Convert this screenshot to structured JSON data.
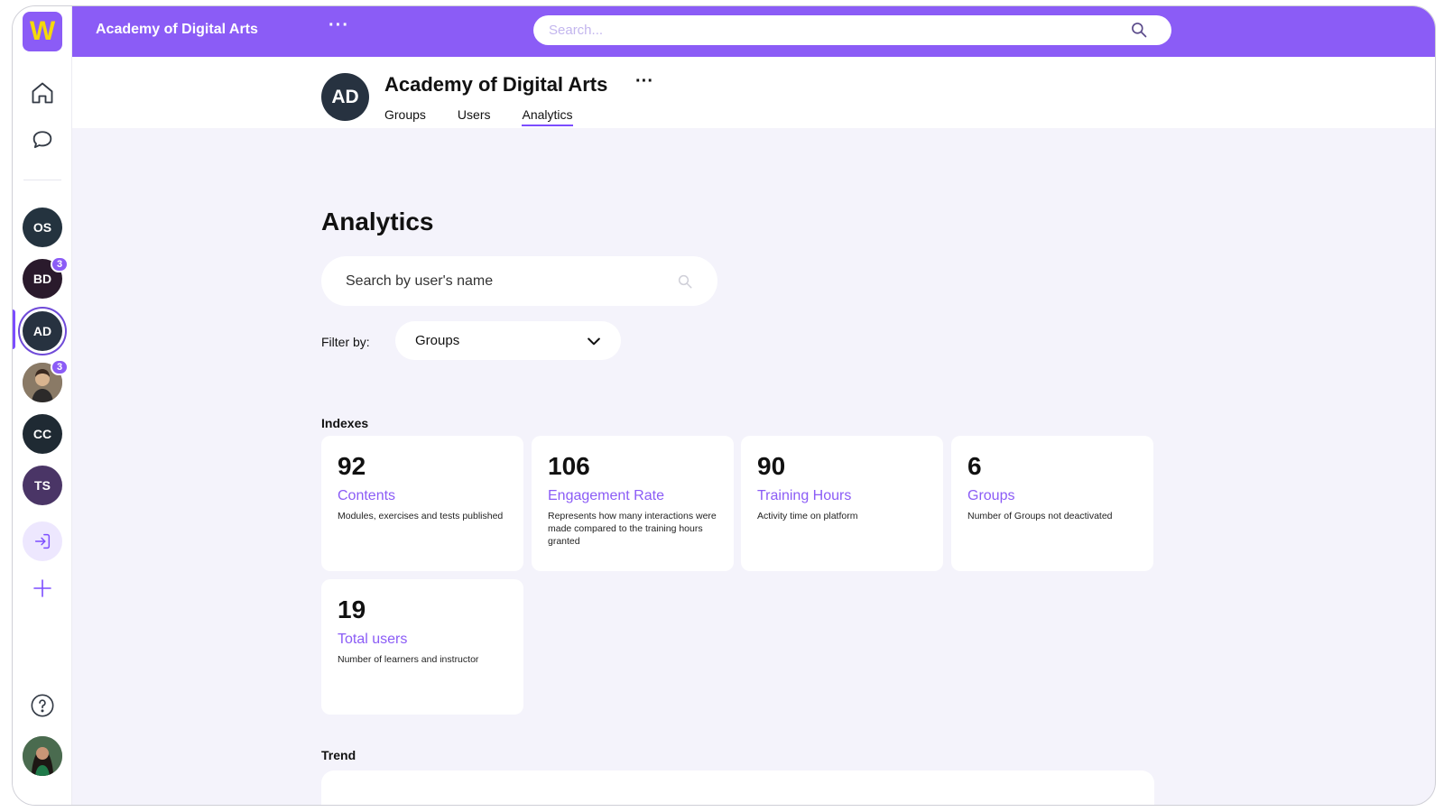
{
  "app": {
    "org_name": "Academy of Digital Arts",
    "logo_letter": "W",
    "brand_color": "#8b5cf6"
  },
  "topbar": {
    "title": "Academy of Digital Arts",
    "more_label": "···",
    "search_placeholder": "Search..."
  },
  "rail": {
    "avatars": [
      {
        "initials": "OS",
        "color": "#24333f"
      },
      {
        "initials": "BD",
        "color": "#2a1a2c",
        "badge": "3"
      },
      {
        "initials": "AD",
        "color": "#273240",
        "active": true
      },
      {
        "initials": "",
        "color": "#6b5a4a",
        "badge": "3",
        "photo": true
      },
      {
        "initials": "CC",
        "color": "#1f2a33"
      },
      {
        "initials": "TS",
        "color": "#4a3566"
      }
    ]
  },
  "header": {
    "avatar_initials": "AD",
    "title": "Academy of Digital Arts",
    "more_label": "···",
    "tabs": [
      {
        "label": "Groups"
      },
      {
        "label": "Users"
      },
      {
        "label": "Analytics",
        "active": true
      }
    ]
  },
  "main": {
    "title": "Analytics",
    "user_search_placeholder": "Search by user's name",
    "filter_label": "Filter by:",
    "filter_value": "Groups",
    "indexes_label": "Indexes",
    "trend_label": "Trend",
    "cards": [
      {
        "value": "92",
        "label": "Contents",
        "desc": "Modules, exercises and tests published"
      },
      {
        "value": "106",
        "label": "Engagement Rate",
        "desc": "Represents how many interactions were made compared to the training hours granted"
      },
      {
        "value": "90",
        "label": "Training Hours",
        "desc": "Activity time on platform"
      },
      {
        "value": "6",
        "label": "Groups",
        "desc": "Number of Groups not deactivated"
      },
      {
        "value": "19",
        "label": "Total users",
        "desc": "Number of learners and instructor"
      }
    ]
  }
}
